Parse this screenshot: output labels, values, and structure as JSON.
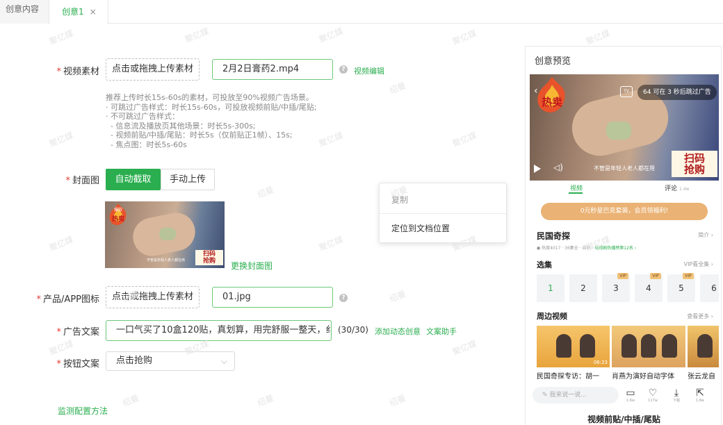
{
  "tabs": {
    "first": "创意内容",
    "active": "创意1",
    "close": "×"
  },
  "form": {
    "video": {
      "label": "视频素材",
      "upload_btn": "点击或拖拽上传素材",
      "filename": "2月2日膏药2.mp4",
      "help": "?",
      "edit_link": "视频编辑",
      "hint": "推荐上传时长15s-60s的素材，可投放至90%视频广告场景。\n· 可跳过广告样式：时长15s-60s，可投放视频前贴/中插/尾贴;\n· 不可跳过广告样式：\n  - 信息流及播放页其他场景：时长5s-300s;\n  - 视频前贴/中插/尾贴：时长5s（仅前贴正1帧）、15s;\n  - 焦点图：时长5s-60s"
    },
    "cover": {
      "label": "封面图",
      "auto": "自动截取",
      "manual": "手动上传",
      "change_link": "更换封面图",
      "badge_hot": "热卖",
      "badge_top": "爆款",
      "badge_scan": "扫码\n抢购",
      "subtitle": "不管是年轻人老人都在用"
    },
    "icon": {
      "label": "产品/APP图标",
      "upload_btn": "点击或拖拽上传素材",
      "filename": "01.jpg",
      "help": "?"
    },
    "ad_text": {
      "label": "广告文案",
      "value": "一口气买了10盒120贴，真划算，用完舒服一整天，纟",
      "count": "(30/30)",
      "link_dynamic": "添加动态创意",
      "link_assist": "文案助手"
    },
    "button_text": {
      "label": "按钮文案",
      "value": "点击抢购",
      "arrow": "⌵"
    },
    "req_mark": "*",
    "monitor_link": "监测配置方法"
  },
  "context_menu": {
    "copy": "复制",
    "locate": "定位到文档位置"
  },
  "preview": {
    "title": "创意预览",
    "video": {
      "ad_tag": "64 可在 3 秒后跳过广告",
      "tv": "TV",
      "back": "‹",
      "subtitle": "不管是年轻人老人都在用",
      "badge_hot": "热卖",
      "badge_scan": "扫码\n抢购",
      "vol": "◁)"
    },
    "tab_video": "视频",
    "tab_comment": "评论",
    "tab_comment_count": "1.4w",
    "vip_bar": "0元秒星巴克套装，会员领福利!",
    "show_title": "民国奇探",
    "show_more": "简介 ›",
    "show_meta_a": "● 热度4017 · 36集全 · 自制 · ",
    "show_meta_b": "电视剧热播榜第12名 ›",
    "episodes_title": "选集",
    "episodes_more": "VIP看全集 ›",
    "episodes": [
      {
        "n": "1",
        "vip": ""
      },
      {
        "n": "2",
        "vip": ""
      },
      {
        "n": "3",
        "vip": "VIP"
      },
      {
        "n": "4",
        "vip": "VIP"
      },
      {
        "n": "5",
        "vip": "VIP"
      },
      {
        "n": "6",
        "vip": ""
      }
    ],
    "nearby_title": "周边视频",
    "nearby_more": "查看更多 ›",
    "nearby": [
      {
        "caption": "民国奇探专访：胡一",
        "dur": "06:23"
      },
      {
        "caption": "肖燕为演好自动字体",
        "dur": ""
      },
      {
        "caption": "张云龙自",
        "dur": ""
      }
    ],
    "comment_placeholder": "✎ 我来说一说...",
    "actions": [
      {
        "icon": "▭",
        "count": "1.6w"
      },
      {
        "icon": "♡",
        "count": "117w"
      },
      {
        "icon": "⤓",
        "count": "下载"
      },
      {
        "icon": "⇱",
        "count": "1.6w"
      }
    ],
    "footer": "视频前贴/中插/尾贴"
  },
  "watermarks": [
    "聚亿媒",
    "绍曼"
  ],
  "colors": {
    "accent": "#2aae4f",
    "required": "#e53935",
    "vip": "#eab274"
  }
}
